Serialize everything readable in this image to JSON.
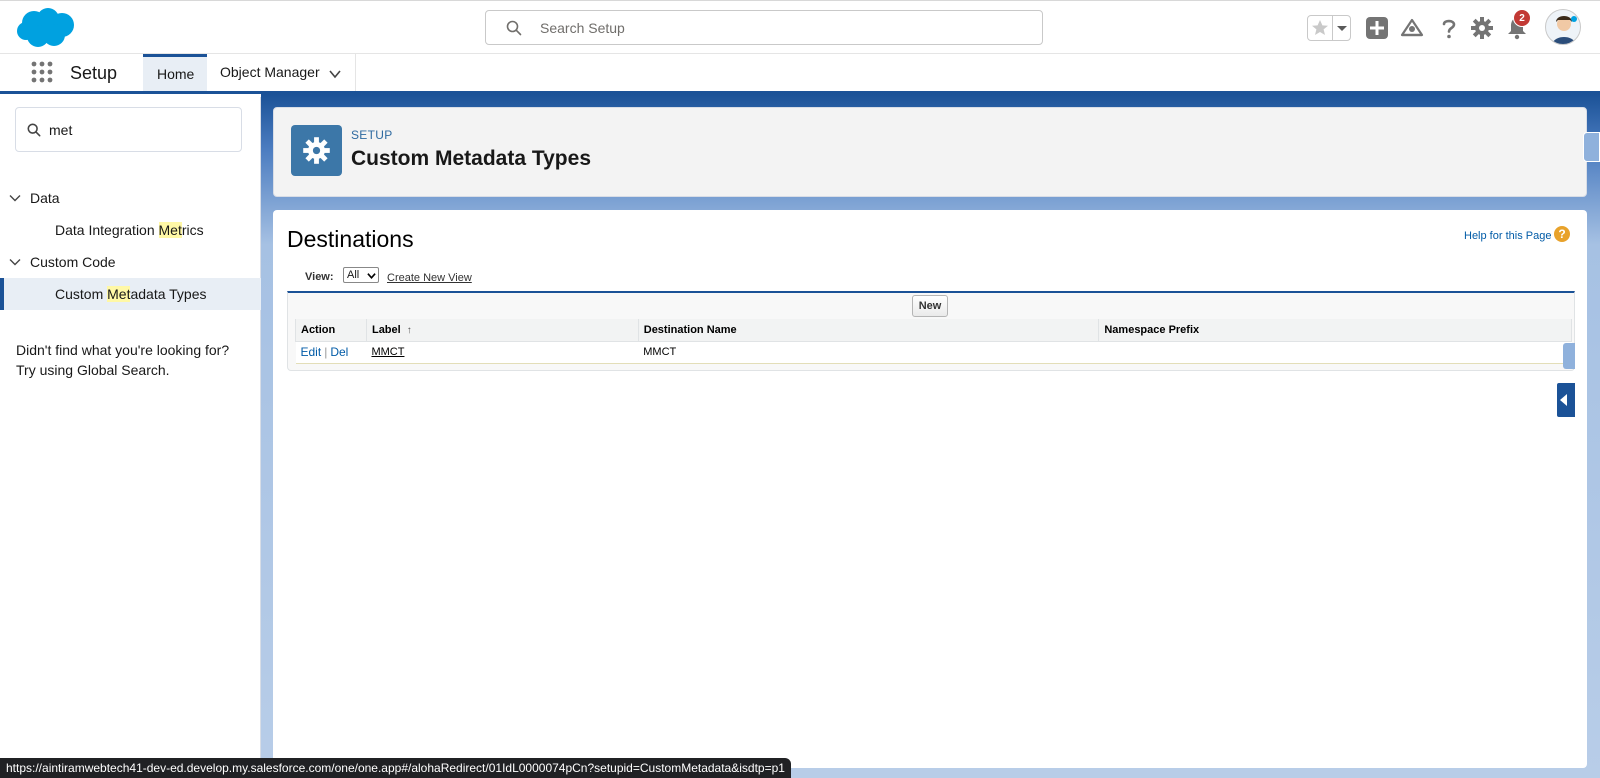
{
  "header": {
    "search_placeholder": "Search Setup",
    "notification_count": "2",
    "brand_color": "#00a1e0"
  },
  "context_nav": {
    "app_name": "Setup",
    "tabs": [
      {
        "label": "Home"
      },
      {
        "label": "Object Manager"
      }
    ]
  },
  "sidebar": {
    "search_value": "met",
    "groups": [
      {
        "label": "Data",
        "items": [
          {
            "pre": "Data Integration ",
            "match": "Met",
            "post": "rics"
          }
        ]
      },
      {
        "label": "Custom Code",
        "items": [
          {
            "pre": "Custom ",
            "match": "Met",
            "post": "adata Types"
          }
        ]
      }
    ],
    "not_found_line1": "Didn't find what you're looking for?",
    "not_found_line2": "Try using Global Search."
  },
  "setup_header": {
    "eyebrow": "SETUP",
    "title": "Custom Metadata Types"
  },
  "content": {
    "heading": "Destinations",
    "help_link": "Help for this Page",
    "help_icon": "?",
    "view_label": "View:",
    "view_value": "All",
    "create_view": "Create New View",
    "new_button": "New",
    "columns": [
      "Action",
      "Label",
      "Destination Name",
      "Namespace Prefix"
    ],
    "sort_arrow": "↑",
    "rows": [
      {
        "edit": "Edit",
        "sep": "|",
        "del": "Del",
        "label": "MMCT",
        "name": "MMCT",
        "prefix": ""
      }
    ]
  },
  "status_bar": {
    "url": "https://aintiramwebtech41-dev-ed.develop.my.salesforce.com/one/one.app#/alohaRedirect/01IdL0000074pCn?setupid=CustomMetadata&isdtp=p1"
  }
}
